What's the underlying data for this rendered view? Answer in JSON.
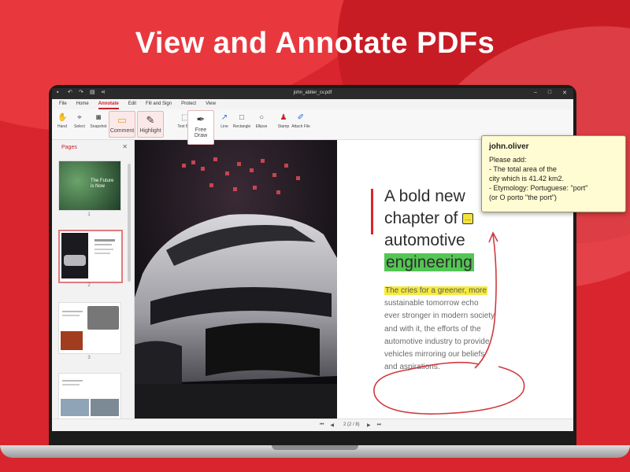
{
  "headline": "View and Annotate PDFs",
  "app": {
    "title": "john_abiter_cv.pdf",
    "menu": [
      "File",
      "Home",
      "Annotate",
      "Edit",
      "Fill and Sign",
      "Protect",
      "View"
    ],
    "active_menu": "Annotate",
    "tools": {
      "hand": "Hand",
      "select": "Select",
      "snapshot": "Snapshot",
      "comment": "Comment",
      "highlight": "Highlight",
      "textbox": "Text Box",
      "freedraw": "Free Draw",
      "line": "Line",
      "rectangle": "Rectangle",
      "ellipse": "Ellipse",
      "stamp": "Stamp",
      "attachfile": "Attach File"
    },
    "sidebar": {
      "title": "Pages",
      "thumb1_text": "The Future is Now",
      "page_numbers": [
        "1",
        "2",
        "3"
      ]
    },
    "document": {
      "heading_lines": [
        "A bold new",
        "chapter of",
        "automotive",
        "engineering"
      ],
      "highlight_line": "The cries for a greener, more",
      "body_lines": [
        "sustainable tomorrow echo",
        "ever stronger in modern society",
        "and with it, the efforts of the",
        "automotive industry to provide",
        "vehicles mirroring our beliefs",
        "and aspirations."
      ]
    },
    "sticky_note": {
      "author": "john.oliver",
      "lines": [
        "Please add:",
        "- The total area of the",
        "city which is 41.42 km2.",
        "- Etymology: Portuguese: \"port\"",
        "(or O porto \"the port\")"
      ]
    },
    "status": {
      "page_indicator": "2 (2 / 8)"
    }
  },
  "colors": {
    "brand_red": "#d9252d",
    "highlight_green": "#53c653",
    "highlight_yellow": "#f6ea3e",
    "sticky_bg": "#fffbd2"
  }
}
